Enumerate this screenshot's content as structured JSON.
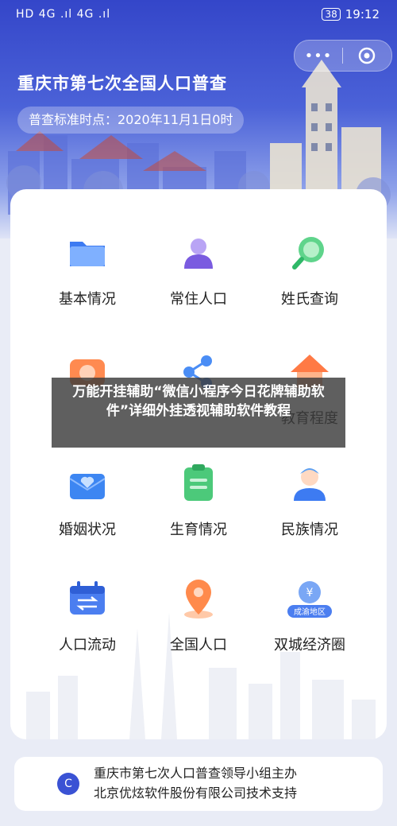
{
  "status_bar": {
    "left": "HD 4G .ıl 4G .ıl",
    "battery": "38",
    "time": "19:12"
  },
  "capsule": {
    "more": "•••"
  },
  "header": {
    "title": "重庆市第七次全国人口普查",
    "date_pill": "普查标准时点：2020年11月1日0时"
  },
  "menu": [
    {
      "label": "基本情况",
      "icon": "folder-icon"
    },
    {
      "label": "常住人口",
      "icon": "person-icon"
    },
    {
      "label": "姓氏查询",
      "icon": "search-icon"
    },
    {
      "label": "",
      "icon": "camera-icon"
    },
    {
      "label": "",
      "icon": "share-icon"
    },
    {
      "label": "教育程度",
      "icon": "house-icon"
    },
    {
      "label": "婚姻状况",
      "icon": "heart-mail-icon"
    },
    {
      "label": "生育情况",
      "icon": "clipboard-icon"
    },
    {
      "label": "民族情况",
      "icon": "ethnic-person-icon"
    },
    {
      "label": "人口流动",
      "icon": "calendar-transfer-icon"
    },
    {
      "label": "全国人口",
      "icon": "location-pin-icon"
    },
    {
      "label": "双城经济圈",
      "icon": "chengyu-badge-icon"
    }
  ],
  "badge_text": "成渝地区",
  "footer": {
    "icon_letter": "C",
    "line1": "重庆市第七次人口普查领导小组主办",
    "line2": "北京优炫软件股份有限公司技术支持"
  },
  "overlay": {
    "text": "万能开挂辅助“微信小程序今日花牌辅助软件”详细外挂透视辅助软件教程"
  }
}
